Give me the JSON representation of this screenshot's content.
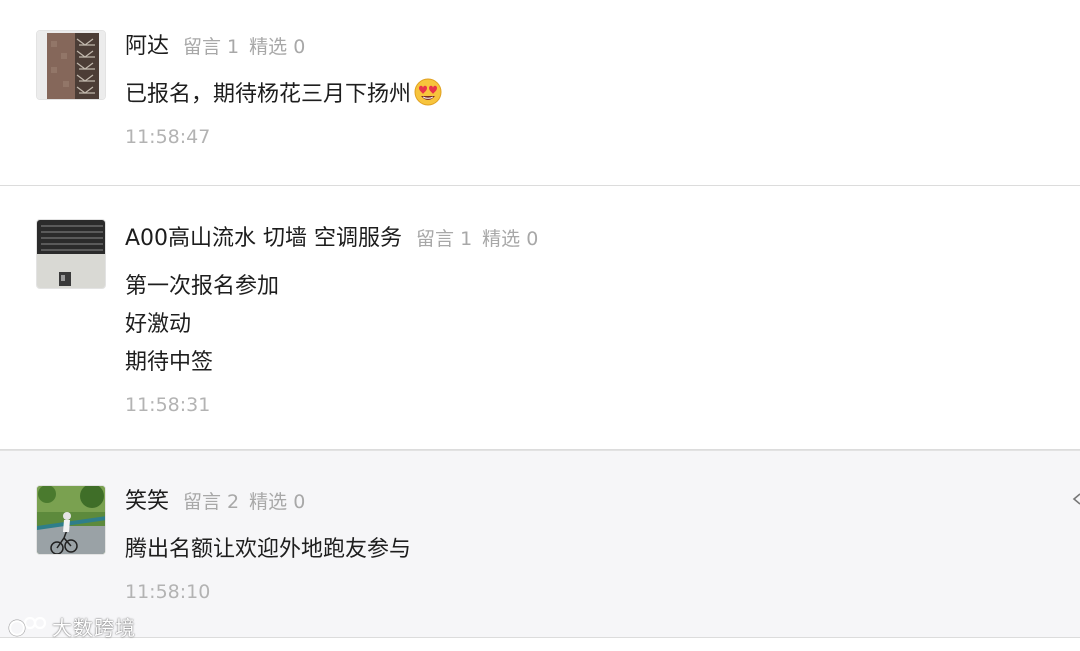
{
  "comments": [
    {
      "name": "阿达",
      "replies_label": "留言 1",
      "featured_label": "精选 0",
      "lines": [
        "已报名，期待杨花三月下扬州"
      ],
      "emoji": "heart-eyes-emoji",
      "time": "11:58:47"
    },
    {
      "name": "A00高山流水 切墙 空调服务",
      "replies_label": "留言 1",
      "featured_label": "精选 0",
      "lines": [
        "第一次报名参加",
        "好激动",
        "期待中签"
      ],
      "time": "11:58:31"
    },
    {
      "name": "笑笑",
      "replies_label": "留言 2",
      "featured_label": "精选 0",
      "lines": [
        "腾出名额让欢迎外地跑友参与"
      ],
      "time": "11:58:10"
    }
  ],
  "watermark": {
    "text": "大数跨境"
  },
  "colors": {
    "name": "#1c1c1c",
    "meta": "#a8a8a8",
    "time": "#b3b3b3",
    "divider": "#dcdcdc",
    "highlight_bg": "#f6f6f8"
  }
}
